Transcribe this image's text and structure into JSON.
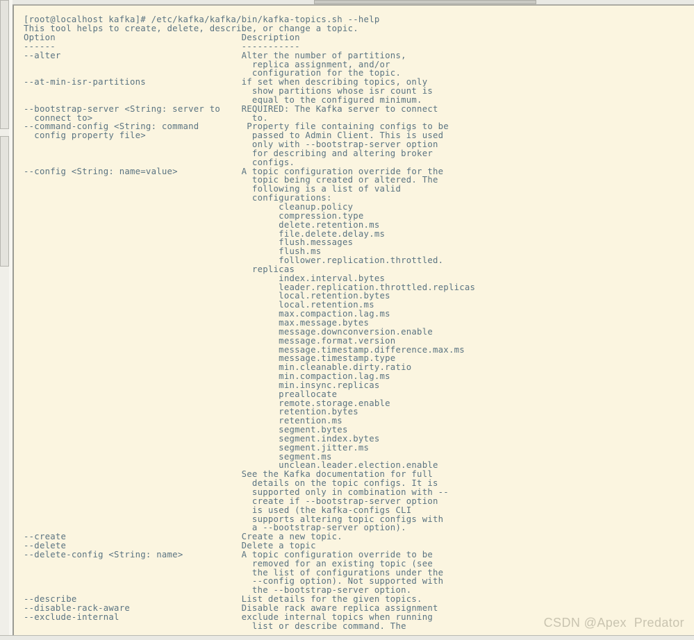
{
  "window": {
    "title": "kafka-topics.sh --help",
    "background_color": "#fbf5e0",
    "text_color": "#5a7381",
    "frame_color": "#d6d6d0"
  },
  "watermark": {
    "text": "CSDN @Apex  Predator"
  },
  "terminal": {
    "prompt": "[root@localhost kafka]#",
    "command": "/etc/kafka/kafka/bin/kafka-topics.sh --help",
    "lines": [
      "[root@localhost kafka]# /etc/kafka/kafka/bin/kafka-topics.sh --help",
      "This tool helps to create, delete, describe, or change a topic.",
      "Option                                   Description",
      "------                                   -----------",
      "--alter                                  Alter the number of partitions,",
      "                                           replica assignment, and/or",
      "                                           configuration for the topic.",
      "--at-min-isr-partitions                  if set when describing topics, only",
      "                                           show partitions whose isr count is",
      "                                           equal to the configured minimum.",
      "--bootstrap-server <String: server to    REQUIRED: The Kafka server to connect",
      "  connect to>                              to.",
      "--command-config <String: command         Property file containing configs to be",
      "  config property file>                    passed to Admin Client. This is used",
      "                                           only with --bootstrap-server option",
      "                                           for describing and altering broker",
      "                                           configs.",
      "--config <String: name=value>            A topic configuration override for the",
      "                                           topic being created or altered. The",
      "                                           following is a list of valid",
      "                                           configurations:",
      "                                                cleanup.policy",
      "                                                compression.type",
      "                                                delete.retention.ms",
      "                                                file.delete.delay.ms",
      "                                                flush.messages",
      "                                                flush.ms",
      "                                                follower.replication.throttled.",
      "                                           replicas",
      "                                                index.interval.bytes",
      "                                                leader.replication.throttled.replicas",
      "                                                local.retention.bytes",
      "                                                local.retention.ms",
      "                                                max.compaction.lag.ms",
      "                                                max.message.bytes",
      "                                                message.downconversion.enable",
      "                                                message.format.version",
      "                                                message.timestamp.difference.max.ms",
      "                                                message.timestamp.type",
      "                                                min.cleanable.dirty.ratio",
      "                                                min.compaction.lag.ms",
      "                                                min.insync.replicas",
      "                                                preallocate",
      "                                                remote.storage.enable",
      "                                                retention.bytes",
      "                                                retention.ms",
      "                                                segment.bytes",
      "                                                segment.index.bytes",
      "                                                segment.jitter.ms",
      "                                                segment.ms",
      "                                                unclean.leader.election.enable",
      "                                         See the Kafka documentation for full",
      "                                           details on the topic configs. It is",
      "                                           supported only in combination with --",
      "                                           create if --bootstrap-server option",
      "                                           is used (the kafka-configs CLI",
      "                                           supports altering topic configs with",
      "                                           a --bootstrap-server option).",
      "--create                                 Create a new topic.",
      "--delete                                 Delete a topic",
      "--delete-config <String: name>           A topic configuration override to be",
      "                                           removed for an existing topic (see",
      "                                           the list of configurations under the",
      "                                           --config option). Not supported with",
      "                                           the --bootstrap-server option.",
      "--describe                               List details for the given topics.",
      "--disable-rack-aware                     Disable rack aware replica assignment",
      "--exclude-internal                       exclude internal topics when running",
      "                                           list or describe command. The"
    ],
    "columns": {
      "option_header": "Option",
      "description_header": "Description",
      "option_rule": "------",
      "description_rule": "-----------"
    },
    "options": [
      {
        "name": "--alter",
        "description": "Alter the number of partitions, replica assignment, and/or configuration for the topic."
      },
      {
        "name": "--at-min-isr-partitions",
        "description": "if set when describing topics, only show partitions whose isr count is equal to the configured minimum."
      },
      {
        "name": "--bootstrap-server <String: server to connect to>",
        "description": "REQUIRED: The Kafka server to connect to."
      },
      {
        "name": "--command-config <String: command config property file>",
        "description": "Property file containing configs to be passed to Admin Client. This is used only with --bootstrap-server option for describing and altering broker configs."
      },
      {
        "name": "--config <String: name=value>",
        "description": "A topic configuration override for the topic being created or altered. The following is a list of valid configurations:"
      },
      {
        "name": "--create",
        "description": "Create a new topic."
      },
      {
        "name": "--delete",
        "description": "Delete a topic"
      },
      {
        "name": "--delete-config <String: name>",
        "description": "A topic configuration override to be removed for an existing topic (see the list of configurations under the --config option). Not supported with the --bootstrap-server option."
      },
      {
        "name": "--describe",
        "description": "List details for the given topics."
      },
      {
        "name": "--disable-rack-aware",
        "description": "Disable rack aware replica assignment"
      },
      {
        "name": "--exclude-internal",
        "description": "exclude internal topics when running list or describe command. The"
      }
    ],
    "valid_configurations": [
      "cleanup.policy",
      "compression.type",
      "delete.retention.ms",
      "file.delete.delay.ms",
      "flush.messages",
      "flush.ms",
      "follower.replication.throttled.replicas",
      "index.interval.bytes",
      "leader.replication.throttled.replicas",
      "local.retention.bytes",
      "local.retention.ms",
      "max.compaction.lag.ms",
      "max.message.bytes",
      "message.downconversion.enable",
      "message.format.version",
      "message.timestamp.difference.max.ms",
      "message.timestamp.type",
      "min.cleanable.dirty.ratio",
      "min.compaction.lag.ms",
      "min.insync.replicas",
      "preallocate",
      "remote.storage.enable",
      "retention.bytes",
      "retention.ms",
      "segment.bytes",
      "segment.index.bytes",
      "segment.jitter.ms",
      "segment.ms",
      "unclean.leader.election.enable"
    ]
  }
}
